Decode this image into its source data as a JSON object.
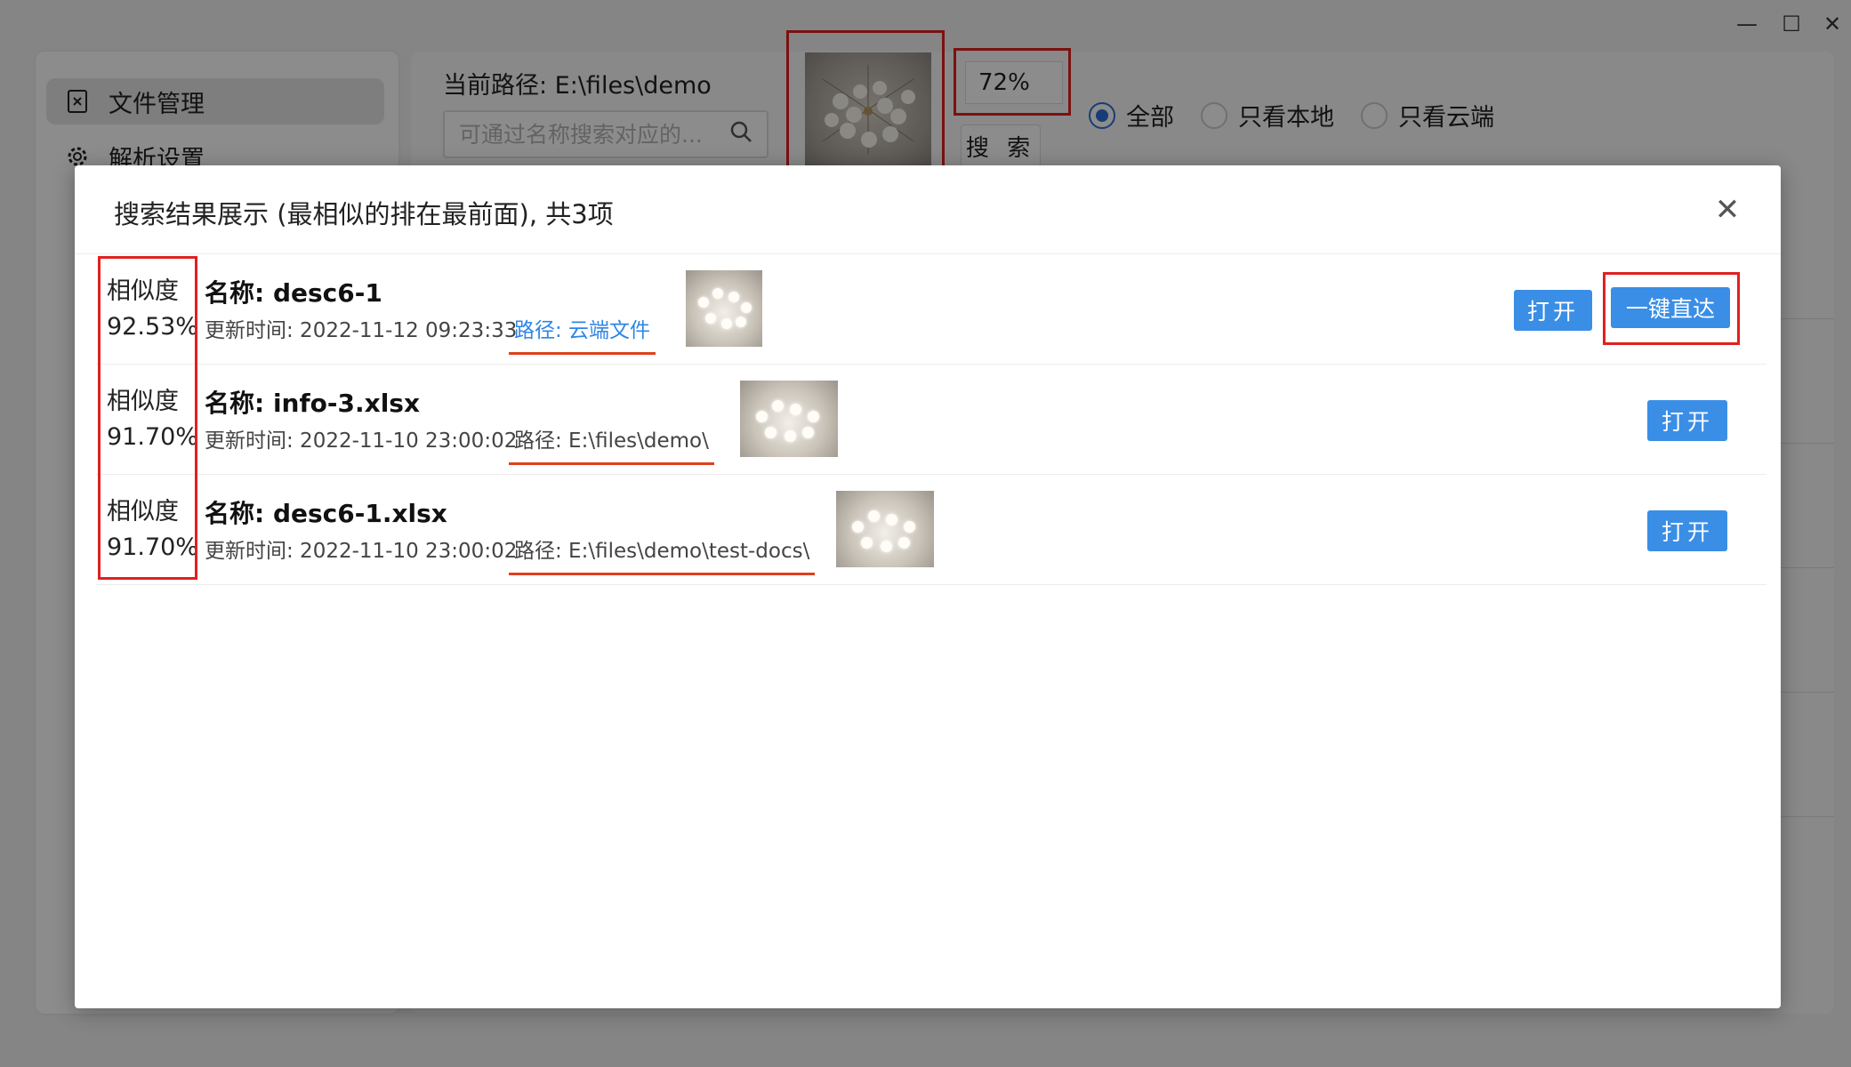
{
  "window": {
    "minimize": "—",
    "maximize": "☐",
    "close": "✕"
  },
  "sidebar": {
    "items": [
      {
        "label": "文件管理",
        "icon": "file-icon",
        "active": true
      },
      {
        "label": "解析设置",
        "icon": "gear-icon",
        "active": false
      }
    ]
  },
  "toolbar": {
    "path_label": "当前路径: E:\\files\\demo",
    "search_placeholder": "可通过名称搜索对应的...",
    "threshold": "72%",
    "search_label": "搜 索",
    "filters": [
      {
        "label": "全部",
        "checked": true
      },
      {
        "label": "只看本地",
        "checked": false
      },
      {
        "label": "只看云端",
        "checked": false
      }
    ]
  },
  "modal": {
    "title": "搜索结果展示 (最相似的排在最前面), 共3项",
    "close": "✕",
    "results": [
      {
        "sim_label": "相似度",
        "sim_value": "92.53%",
        "name": "名称: desc6-1",
        "time": "更新时间: 2022-11-12 09:23:33",
        "path": "路径: 云端文件",
        "open_label": "打开",
        "direct_label": "一键直达"
      },
      {
        "sim_label": "相似度",
        "sim_value": "91.70%",
        "name": "名称: info-3.xlsx",
        "time": "更新时间: 2022-11-10 23:00:02",
        "path": "路径: E:\\files\\demo\\",
        "open_label": "打开"
      },
      {
        "sim_label": "相似度",
        "sim_value": "91.70%",
        "name": "名称: desc6-1.xlsx",
        "time": "更新时间: 2022-11-10 23:00:02",
        "path": "路径: E:\\files\\demo\\test-docs\\",
        "open_label": "打开"
      }
    ]
  }
}
